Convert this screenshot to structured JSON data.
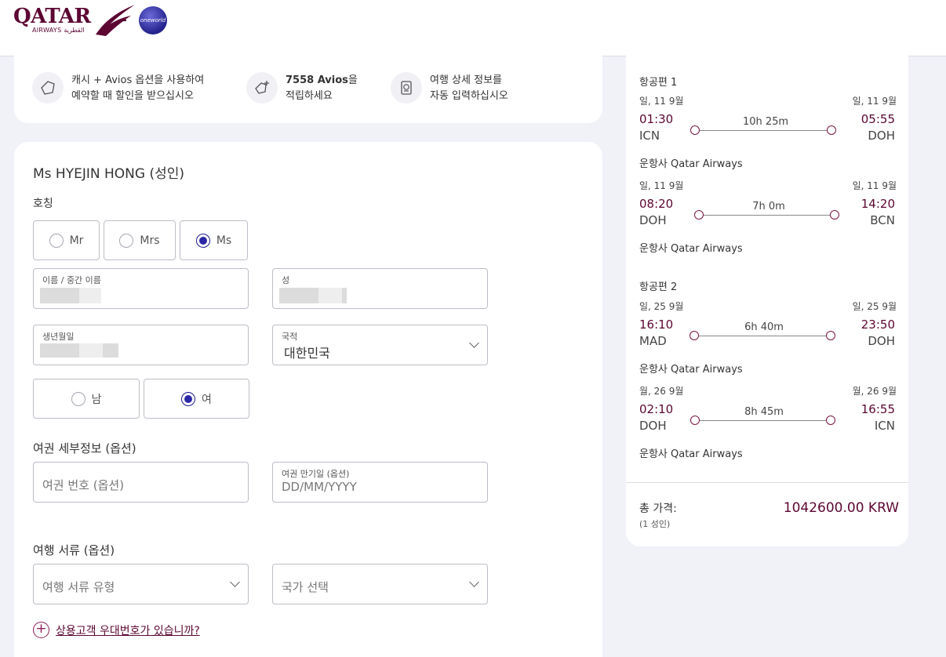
{
  "header": {
    "logo_text": "QATAR",
    "logo_sub": "AIRWAYS القطرية",
    "alliance": "oneworld"
  },
  "promo": [
    {
      "line1": "캐시 + Avios 옵션을 사용하여",
      "line2": "예약할 때 할인을 받으십시오"
    },
    {
      "line1_bold": "7558 Avios",
      "line1_rest": "을",
      "line2": "적립하세요"
    },
    {
      "line1": "여행 상세 정보를",
      "line2": "자동 입력하십시오"
    }
  ],
  "passenger": {
    "name": "Ms HYEJIN HONG (성인)",
    "title_label": "호칭",
    "titles": [
      "Mr",
      "Mrs",
      "Ms"
    ],
    "selected_title": "Ms",
    "first_name_label": "이름 / 중간 이름",
    "last_name_label": "성",
    "dob_label": "생년월일",
    "nationality_label": "국적",
    "nationality_value": "대한민국",
    "genders": [
      "남",
      "여"
    ],
    "selected_gender": "여"
  },
  "passport": {
    "section": "여권 세부정보 (옵션)",
    "number_placeholder": "여권 번호 (옵션)",
    "expiry_label": "여권 만기일 (옵션)",
    "expiry_placeholder": "DD/MM/YYYY"
  },
  "documents": {
    "section": "여행 서류 (옵션)",
    "type_placeholder": "여행 서류 유형",
    "country_placeholder": "국가 선택"
  },
  "frequent_flyer_link": "상용고객 우대번호가 있습니까?",
  "summary": {
    "flights": [
      {
        "heading": "항공편 1",
        "legs": [
          {
            "dep_date": "일, 11 9월",
            "arr_date": "일, 11 9월",
            "dep_time": "01:30",
            "arr_time": "05:55",
            "dep_code": "ICN",
            "arr_code": "DOH",
            "duration": "10h 25m",
            "operator": "운항사 Qatar Airways"
          },
          {
            "dep_date": "일, 11 9월",
            "arr_date": "일, 11 9월",
            "dep_time": "08:20",
            "arr_time": "14:20",
            "dep_code": "DOH",
            "arr_code": "BCN",
            "duration": "7h 0m",
            "operator": "운항사 Qatar Airways"
          }
        ]
      },
      {
        "heading": "항공편 2",
        "legs": [
          {
            "dep_date": "일, 25 9월",
            "arr_date": "일, 25 9월",
            "dep_time": "16:10",
            "arr_time": "23:50",
            "dep_code": "MAD",
            "arr_code": "DOH",
            "duration": "6h 40m",
            "operator": "운항사 Qatar Airways"
          },
          {
            "dep_date": "월, 26 9월",
            "arr_date": "월, 26 9월",
            "dep_time": "02:10",
            "arr_time": "16:55",
            "dep_code": "DOH",
            "arr_code": "ICN",
            "duration": "8h 45m",
            "operator": "운항사 Qatar Airways"
          }
        ]
      }
    ],
    "total_label": "총 가격:",
    "total_sub": "(1 성인)",
    "total_value": "1042600.00 KRW"
  },
  "colors": {
    "brand": "#5c0632",
    "radio": "#2b27a8",
    "background": "#f1f1f8"
  }
}
